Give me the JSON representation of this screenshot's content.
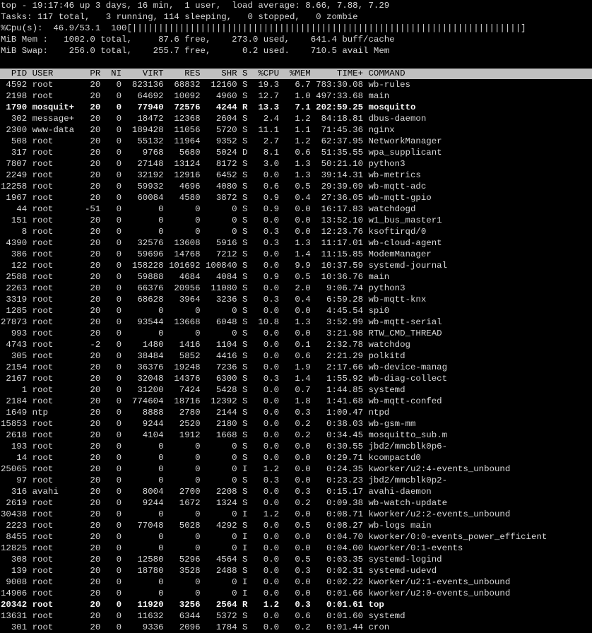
{
  "summary": {
    "top_line": "top - 19:17:46 up 3 days, 16 min,  1 user,  load average: 8.66, 7.88, 7.29",
    "tasks_line": "Tasks: 117 total,   3 running, 114 sleeping,   0 stopped,   0 zombie",
    "cpu_line": "%Cpu(s):  46.9/53.1  100[||||||||||||||||||||||||||||||||||||||||||||||||||||||||||||||||||||||||||]",
    "mem_line": "MiB Mem :   1002.0 total,     87.6 free,    273.0 used,    641.4 buff/cache",
    "swap_line": "MiB Swap:    256.0 total,    255.7 free,      0.2 used.    710.5 avail Mem",
    "blank_line": " "
  },
  "table": {
    "header": "  PID USER       PR  NI    VIRT    RES    SHR S  %CPU  %MEM     TIME+ COMMAND",
    "rows": [
      {
        "text": " 4592 root       20   0  823136  68832  12160 S  19.3   6.7 783:30.08 wb-rules",
        "state": "S"
      },
      {
        "text": " 2198 root       20   0   64692  10092   4960 S  12.7   1.0 497:33.68 main",
        "state": "S"
      },
      {
        "text": " 1790 mosquit+   20   0   77940  72576   4244 R  13.3   7.1 202:59.25 mosquitto",
        "state": "R"
      },
      {
        "text": "  302 message+   20   0   18472  12368   2604 S   2.4   1.2  84:18.81 dbus-daemon",
        "state": "S"
      },
      {
        "text": " 2300 www-data   20   0  189428  11056   5720 S  11.1   1.1  71:45.36 nginx",
        "state": "S"
      },
      {
        "text": "  508 root       20   0   55132  11964   9352 S   2.7   1.2  62:37.95 NetworkManager",
        "state": "S"
      },
      {
        "text": "  317 root       20   0    9768   5680   5024 D   8.1   0.6  51:35.55 wpa_supplicant",
        "state": "D"
      },
      {
        "text": " 7807 root       20   0   27148  13124   8172 S   3.0   1.3  50:21.10 python3",
        "state": "S"
      },
      {
        "text": " 2249 root       20   0   32192  12916   6452 S   0.0   1.3  39:14.31 wb-metrics",
        "state": "S"
      },
      {
        "text": "12258 root       20   0   59932   4696   4080 S   0.6   0.5  29:39.09 wb-mqtt-adc",
        "state": "S"
      },
      {
        "text": " 1967 root       20   0   60084   4580   3872 S   0.9   0.4  27:36.05 wb-mqtt-gpio",
        "state": "S"
      },
      {
        "text": "   44 root      -51   0       0      0      0 S   0.9   0.0  16:17.83 watchdogd",
        "state": "S"
      },
      {
        "text": "  151 root       20   0       0      0      0 S   0.0   0.0  13:52.10 w1_bus_master1",
        "state": "S"
      },
      {
        "text": "    8 root       20   0       0      0      0 S   0.3   0.0  12:23.76 ksoftirqd/0",
        "state": "S"
      },
      {
        "text": " 4390 root       20   0   32576  13608   5916 S   0.3   1.3  11:17.01 wb-cloud-agent",
        "state": "S"
      },
      {
        "text": "  386 root       20   0   59696  14768   7212 S   0.0   1.4  11:15.85 ModemManager",
        "state": "S"
      },
      {
        "text": "  122 root       20   0  158228 101692 100840 S   0.0   9.9  10:37.59 systemd-journal",
        "state": "S"
      },
      {
        "text": " 2588 root       20   0   59888   4684   4084 S   0.9   0.5  10:36.76 main",
        "state": "S"
      },
      {
        "text": " 2263 root       20   0   66376  20956  11080 S   0.0   2.0   9:06.74 python3",
        "state": "S"
      },
      {
        "text": " 3319 root       20   0   68628   3964   3236 S   0.3   0.4   6:59.28 wb-mqtt-knx",
        "state": "S"
      },
      {
        "text": " 1285 root       20   0       0      0      0 S   0.0   0.0   4:45.54 spi0",
        "state": "S"
      },
      {
        "text": "27873 root       20   0   93544  13668   6048 S  10.8   1.3   3:52.99 wb-mqtt-serial",
        "state": "S"
      },
      {
        "text": "  993 root       20   0       0      0      0 S   0.0   0.0   3:21.98 RTW_CMD_THREAD",
        "state": "S"
      },
      {
        "text": " 4743 root       -2   0    1480   1416   1104 S   0.0   0.1   2:32.78 watchdog",
        "state": "S"
      },
      {
        "text": "  305 root       20   0   38484   5852   4416 S   0.0   0.6   2:21.29 polkitd",
        "state": "S"
      },
      {
        "text": " 2154 root       20   0   36376  19248   7236 S   0.0   1.9   2:17.66 wb-device-manag",
        "state": "S"
      },
      {
        "text": " 2167 root       20   0   32048  14376   6300 S   0.3   1.4   1:55.92 wb-diag-collect",
        "state": "S"
      },
      {
        "text": "    1 root       20   0   31200   7424   5428 S   0.0   0.7   1:44.85 systemd",
        "state": "S"
      },
      {
        "text": " 2184 root       20   0  774604  18716  12392 S   0.0   1.8   1:41.68 wb-mqtt-confed",
        "state": "S"
      },
      {
        "text": " 1649 ntp        20   0    8888   2780   2144 S   0.0   0.3   1:00.47 ntpd",
        "state": "S"
      },
      {
        "text": "15853 root       20   0    9244   2520   2180 S   0.0   0.2   0:38.03 wb-gsm-mm",
        "state": "S"
      },
      {
        "text": " 2618 root       20   0    4104   1912   1668 S   0.0   0.2   0:34.45 mosquitto_sub.m",
        "state": "S"
      },
      {
        "text": "  193 root       20   0       0      0      0 S   0.0   0.0   0:30.55 jbd2/mmcblk0p6-",
        "state": "S"
      },
      {
        "text": "   14 root       20   0       0      0      0 S   0.0   0.0   0:29.71 kcompactd0",
        "state": "S"
      },
      {
        "text": "25065 root       20   0       0      0      0 I   1.2   0.0   0:24.35 kworker/u2:4-events_unbound",
        "state": "I"
      },
      {
        "text": "   97 root       20   0       0      0      0 S   0.3   0.0   0:23.23 jbd2/mmcblk0p2-",
        "state": "S"
      },
      {
        "text": "  316 avahi      20   0    8004   2700   2208 S   0.0   0.3   0:15.17 avahi-daemon",
        "state": "S"
      },
      {
        "text": " 2619 root       20   0    9244   1672   1324 S   0.0   0.2   0:09.38 wb-watch-update",
        "state": "S"
      },
      {
        "text": "30438 root       20   0       0      0      0 I   1.2   0.0   0:08.71 kworker/u2:2-events_unbound",
        "state": "I"
      },
      {
        "text": " 2223 root       20   0   77048   5028   4292 S   0.0   0.5   0:08.27 wb-logs main",
        "state": "S"
      },
      {
        "text": " 8455 root       20   0       0      0      0 I   0.0   0.0   0:04.70 kworker/0:0-events_power_efficient",
        "state": "I"
      },
      {
        "text": "12825 root       20   0       0      0      0 I   0.0   0.0   0:04.00 kworker/0:1-events",
        "state": "I"
      },
      {
        "text": "  308 root       20   0   12580   5296   4564 S   0.0   0.5   0:03.35 systemd-logind",
        "state": "S"
      },
      {
        "text": "  139 root       20   0   18780   3528   2488 S   0.0   0.3   0:02.31 systemd-udevd",
        "state": "S"
      },
      {
        "text": " 9008 root       20   0       0      0      0 I   0.0   0.0   0:02.22 kworker/u2:1-events_unbound",
        "state": "I"
      },
      {
        "text": "14906 root       20   0       0      0      0 I   0.0   0.0   0:01.66 kworker/u2:0-events_unbound",
        "state": "I"
      },
      {
        "text": "20342 root       20   0   11920   3256   2564 R   1.2   0.3   0:01.61 top",
        "state": "R"
      },
      {
        "text": "13631 root       20   0   11632   6344   5372 S   0.0   0.6   0:01.60 systemd",
        "state": "S"
      },
      {
        "text": "  301 root       20   0    9336   2096   1784 S   0.0   0.2   0:01.44 cron",
        "state": "S"
      }
    ]
  },
  "colors": {
    "background": "#000000",
    "text": "#d8d8d8",
    "running_text": "#f4f4f4",
    "header_bar": "#c0c0c0",
    "header_text": "#000000"
  }
}
